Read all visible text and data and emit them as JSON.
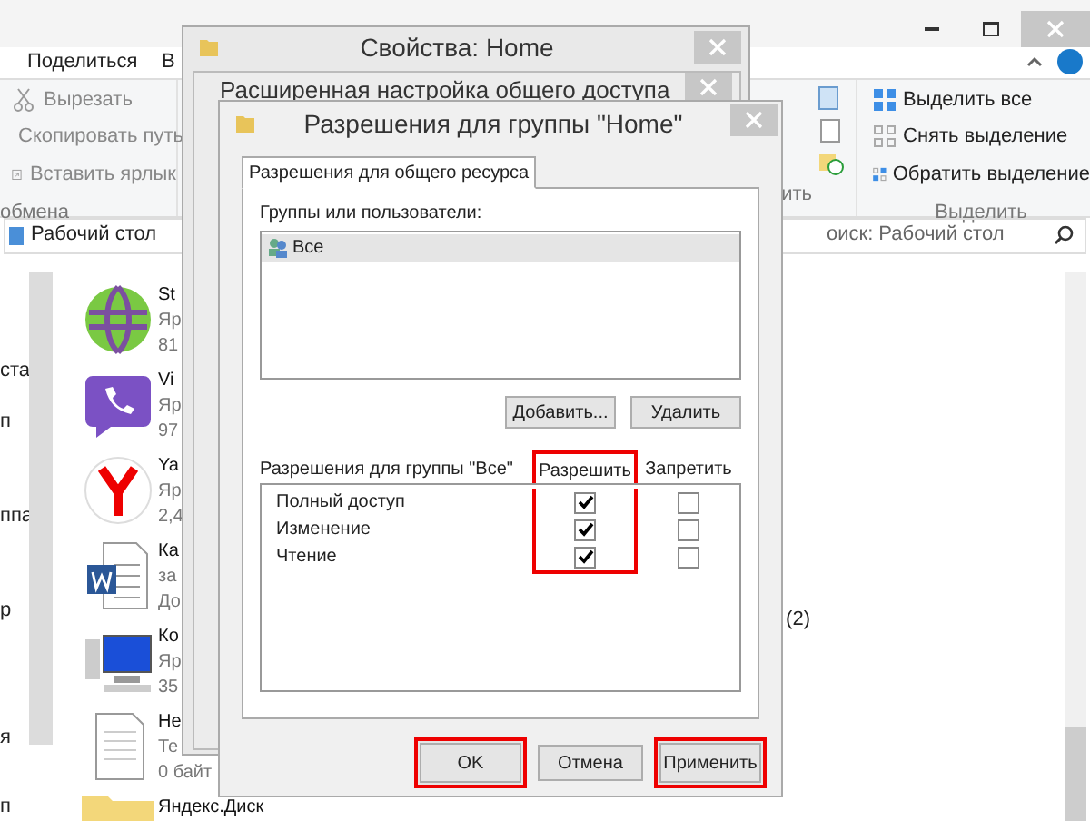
{
  "explorer": {
    "ribbon_tabs": [
      {
        "label": "Поделиться"
      },
      {
        "label": "В"
      }
    ],
    "clipboard_group": {
      "items": [
        {
          "label": "Вырезать",
          "kind": "cut"
        },
        {
          "label": "Скопировать путь",
          "kind": "path"
        },
        {
          "label": "Вставить ярлык",
          "kind": "shortcut"
        }
      ],
      "label": "обмена"
    },
    "open_group": {
      "label": "ить"
    },
    "select_group": {
      "items": [
        {
          "label": "Выделить все",
          "kind": "all"
        },
        {
          "label": "Снять выделение",
          "kind": "none"
        },
        {
          "label": "Обратить выделение",
          "kind": "invert"
        }
      ],
      "label": "Выделить"
    },
    "address": "Рабочий стол",
    "search": {
      "placeholder": "оиск: Рабочий стол"
    },
    "nav_items": [
      "ста",
      "п",
      "ппа",
      "р",
      "я",
      "п"
    ],
    "files": [
      {
        "kind": "globe",
        "lines": [
          "St",
          "Яр",
          "81"
        ]
      },
      {
        "kind": "phone",
        "lines": [
          "Vi",
          "Яр",
          "97"
        ]
      },
      {
        "kind": "yandex",
        "lines": [
          "Ya",
          "Яр",
          "2,4"
        ]
      },
      {
        "kind": "word",
        "lines": [
          "Ка",
          "за",
          "До"
        ]
      },
      {
        "kind": "computer",
        "lines": [
          "Ко",
          "Яр",
          "35"
        ]
      },
      {
        "kind": "text",
        "lines": [
          "Не",
          "Те",
          "0 байт"
        ]
      },
      {
        "kind": "folder",
        "lines": [
          "Яндекс.Диск"
        ]
      }
    ],
    "side_count": "(2)"
  },
  "properties_dialog": {
    "title": "Свойства: Home"
  },
  "advanced_dialog": {
    "title": "Расширенная настройка общего доступа"
  },
  "permissions_dialog": {
    "title": "Разрешения для группы \"Home\"",
    "tabs": [
      {
        "label": "Разрешения для общего ресурса",
        "selected": true
      }
    ],
    "groups_label": "Группы или пользователи:",
    "groups": [
      {
        "name": "Все",
        "selected": true
      }
    ],
    "group_buttons": [
      "Добавить...",
      "Удалить"
    ],
    "permissions_label": "Разрешения для группы \"Все\"",
    "columns": [
      {
        "label": "Разрешить",
        "highlighted": true
      },
      {
        "label": "Запретить",
        "highlighted": false
      }
    ],
    "rows": [
      {
        "name": "Полный доступ",
        "allow": true,
        "deny": false
      },
      {
        "name": "Изменение",
        "allow": true,
        "deny": false
      },
      {
        "name": "Чтение",
        "allow": true,
        "deny": false
      }
    ],
    "buttons": [
      {
        "label": "OK",
        "highlighted": true
      },
      {
        "label": "Отмена",
        "highlighted": false
      },
      {
        "label": "Применить",
        "highlighted": true
      }
    ]
  }
}
